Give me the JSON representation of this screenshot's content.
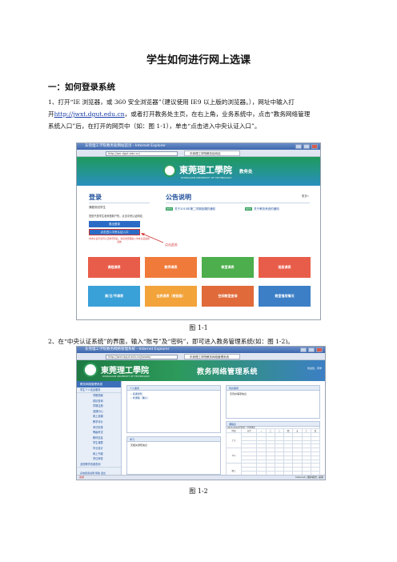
{
  "doc": {
    "title": "学生如何进行网上选课",
    "section1_heading": "一：如何登录系统",
    "para1_lines": [
      "1、打开“IE 浏览器，或 360 安全浏览器”（建议使用 IE9 以上版的浏览器。），网址中输入打",
      "系统入口”后，在打开的网页中（如：图 1-1），单击“点击进入中央认证入口”。"
    ],
    "para1_line2_prefix": "开",
    "para1_link": "http://jwxt.dgut.edu.cn",
    "para1_line2_suffix": "，或者打开教务处主页，在右上角，业务系统中，点击“教务网络管理",
    "caption1": "图 1-1",
    "para2": "2、在“中央认证系统”的界面，输入“账号”及“密码”，即可进入教务管理系统(如：图 1-2)。",
    "caption2": "图 1-2"
  },
  "shot1": {
    "window_title": "东莞理工学院教务处网站首页 - Internet Explorer",
    "address": "http://jwc.dgut.edu.cn/",
    "tab_label": "东莞理工学院教务处网站",
    "school_name": "東莞理工學院",
    "school_name_en": "DONGGUAN UNIVERSITY OF TECHNOLOGY",
    "dept": "教务处",
    "login_heading": "登录",
    "user_line": "课程测试学生",
    "forgot_line": "您是不是学生老师是新户的，点击中央认证网站",
    "exit_button": "退出登录",
    "cas_button": "点击进入中央认证入口",
    "note": "中央认证平台可以正常登录后，请点击页面进入中央认证后的系统",
    "click_here": "点击此处",
    "announce_heading": "公告说明",
    "announce_more": "更多»",
    "announce_items": [
      {
        "tag": "NEW",
        "text": "关于2015年第二学期选课的通知"
      },
      {
        "tag": "NEW",
        "text": "关于教务系统的通知"
      }
    ],
    "tiles_row1": [
      "课程课表",
      "教师课表",
      "教室课表",
      "班级课表"
    ],
    "tiles_row2": [
      "周/日/节课表",
      "全校课表（按班级）",
      "空闲教室查询",
      "教室借用情况"
    ],
    "tile_colors_row1": [
      "#e85d4a",
      "#f07a3a",
      "#4cae4c",
      "#e85d4a"
    ],
    "tile_colors_row2": [
      "#3aa0d8",
      "#f2a33a",
      "#e06a3a",
      "#3c7fc6"
    ]
  },
  "shot2": {
    "window_title": "东莞理工学院教务网络管理系统 - Internet Explorer",
    "address": "http://jwxt.dgut.edu.cn/jwweb/",
    "tab_label": "东莞理工学院教务网络管理系统",
    "school_name": "東莞理工學院",
    "school_name_en": "DONGGUAN UNIVERSITY OF TECHNOLOGY",
    "system_name": "教务网络管理系统",
    "user_info": "欢迎您，同学",
    "side_header": "教务网络管理系统",
    "side_sub": "学生个人信息服务",
    "side_items": [
      "学籍档案",
      "成绩查询",
      "学期注册",
      "选课中心",
      "网上选课",
      "教学评价",
      "考试安排",
      "等级考试",
      "教材信息",
      "学生课表",
      "毕业设计",
      "网上书城",
      "学位审查"
    ],
    "side_extra": "全校教学资源查询",
    "side_foot": "系统使用说明  帮助  退出",
    "panel1_title": "个人事务",
    "panel1_items": [
      "• 选课通知",
      "• 修课程（确认）"
    ],
    "panel2_title": "学习",
    "panel2_text": "无相关通知信息",
    "panel3_title": "待办事项",
    "panel3_text": "无待办事项信息",
    "panel4_title": "课程表",
    "panel4_text": "2015-2016学年第二学期课表",
    "sched_head": [
      "时段",
      "节次",
      "一",
      "二",
      "三",
      "四",
      "五",
      "六",
      "日"
    ],
    "sched_periods": [
      "上午",
      "下午",
      "晚上"
    ],
    "status_text": "完成",
    "status_right": "Internet | 保护模式: 禁用"
  }
}
